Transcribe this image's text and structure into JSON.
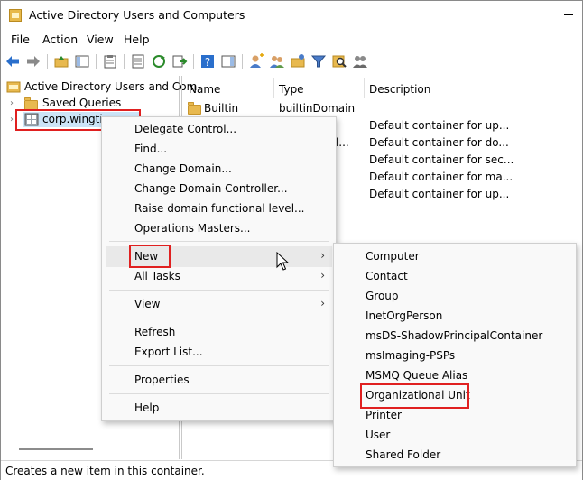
{
  "window": {
    "title": "Active Directory Users and Computers"
  },
  "menubar": {
    "items": [
      "File",
      "Action",
      "View",
      "Help"
    ]
  },
  "tree": {
    "root_label": "Active Directory Users and Com",
    "items": [
      {
        "label": "Saved Queries"
      },
      {
        "label": "corp.wingtip"
      }
    ]
  },
  "list": {
    "columns": [
      "Name",
      "Type",
      "Description"
    ],
    "rows": [
      {
        "name": "Builtin",
        "type": "builtinDomain",
        "description": ""
      },
      {
        "name": "",
        "type": "nal...",
        "description": "Default container for up..."
      },
      {
        "name": "",
        "type": "",
        "description": "Default container for do..."
      },
      {
        "name": "",
        "type": "",
        "description": "Default container for sec..."
      },
      {
        "name": "",
        "type": "",
        "description": "Default container for ma..."
      },
      {
        "name": "",
        "type": "",
        "description": "Default container for up..."
      }
    ]
  },
  "context_menu": {
    "items": [
      "Delegate Control...",
      "Find...",
      "Change Domain...",
      "Change Domain Controller...",
      "Raise domain functional level...",
      "Operations Masters...",
      "New",
      "All Tasks",
      "View",
      "Refresh",
      "Export List...",
      "Properties",
      "Help"
    ],
    "submenu_arrow": "›"
  },
  "submenu": {
    "items": [
      "Computer",
      "Contact",
      "Group",
      "InetOrgPerson",
      "msDS-ShadowPrincipalContainer",
      "msImaging-PSPs",
      "MSMQ Queue Alias",
      "Organizational Unit",
      "Printer",
      "User",
      "Shared Folder"
    ]
  },
  "statusbar": {
    "text": "Creates a new item in this container."
  },
  "colors": {
    "highlight_red": "#e02020",
    "folder": "#e8b94f",
    "toolbar_blue": "#2a6fcc"
  }
}
